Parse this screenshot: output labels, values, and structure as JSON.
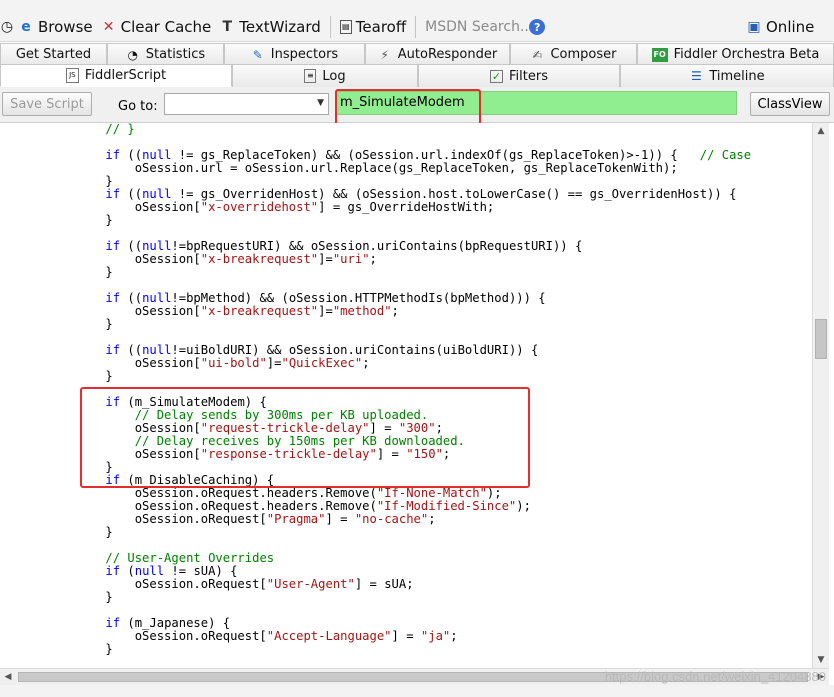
{
  "toolbar": {
    "browse": "Browse",
    "clear_cache": "Clear Cache",
    "text_wizard": "TextWizard",
    "tearoff": "Tearoff",
    "msdn_search": "MSDN Search...",
    "online": "Online"
  },
  "tabs_row1": {
    "get_started": "Get Started",
    "statistics": "Statistics",
    "inspectors": "Inspectors",
    "autoresponder": "AutoResponder",
    "composer": "Composer",
    "fiddler_orchestra": "Fiddler Orchestra Beta"
  },
  "tabs_row2": {
    "fiddlerscript": "FiddlerScript",
    "log": "Log",
    "filters": "Filters",
    "timeline": "Timeline"
  },
  "script_toolbar": {
    "save_script": "Save Script",
    "goto_label": "Go to:",
    "goto_value": "",
    "search_value": "m_SimulateModem",
    "classview": "ClassView"
  },
  "colors": {
    "keyword": "#0000ff",
    "string": "#a31515",
    "comment": "#008000",
    "highlight": "#90ee90",
    "annotation_box": "#e52d2d"
  },
  "code_lines": [
    "    // }",
    "",
    "    if ((null != gs_ReplaceToken) && (oSession.url.indexOf(gs_ReplaceToken)>-1)) {   // Case",
    "        oSession.url = oSession.url.Replace(gs_ReplaceToken, gs_ReplaceTokenWith);",
    "    }",
    "    if ((null != gs_OverridenHost) && (oSession.host.toLowerCase() == gs_OverridenHost)) {",
    "        oSession[\"x-overridehost\"] = gs_OverrideHostWith;",
    "    }",
    "",
    "    if ((null!=bpRequestURI) && oSession.uriContains(bpRequestURI)) {",
    "        oSession[\"x-breakrequest\"]=\"uri\";",
    "    }",
    "",
    "    if ((null!=bpMethod) && (oSession.HTTPMethodIs(bpMethod))) {",
    "        oSession[\"x-breakrequest\"]=\"method\";",
    "    }",
    "",
    "    if ((null!=uiBoldURI) && oSession.uriContains(uiBoldURI)) {",
    "        oSession[\"ui-bold\"]=\"QuickExec\";",
    "    }",
    "",
    "    if (m_SimulateModem) {",
    "        // Delay sends by 300ms per KB uploaded.",
    "        oSession[\"request-trickle-delay\"] = \"300\";",
    "        // Delay receives by 150ms per KB downloaded.",
    "        oSession[\"response-trickle-delay\"] = \"150\";",
    "    }",
    "    if (m_DisableCaching) {",
    "        oSession.oRequest.headers.Remove(\"If-None-Match\");",
    "        oSession.oRequest.headers.Remove(\"If-Modified-Since\");",
    "        oSession.oRequest[\"Pragma\"] = \"no-cache\";",
    "    }",
    "",
    "    // User-Agent Overrides",
    "    if (null != sUA) {",
    "        oSession.oRequest[\"User-Agent\"] = sUA;",
    "    }",
    "",
    "    if (m_Japanese) {",
    "        oSession.oRequest[\"Accept-Language\"] = \"ja\";",
    "    }"
  ],
  "watermark": "https://blog.csdn.net/weixin_41204880"
}
